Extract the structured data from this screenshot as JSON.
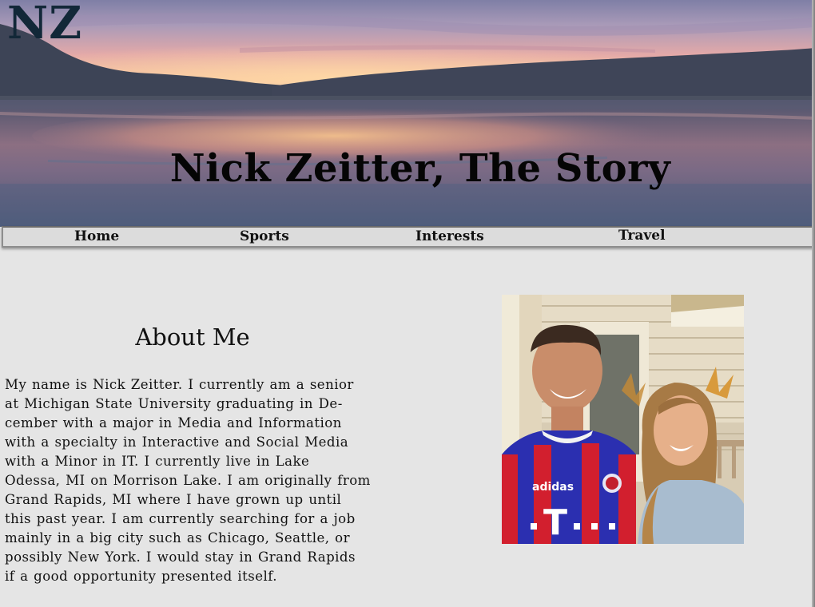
{
  "site": {
    "logo": "NZ",
    "title": "Nick Zeitter, The Story"
  },
  "nav": {
    "items": [
      {
        "label": "Home"
      },
      {
        "label": "Sports"
      },
      {
        "label": "Interests"
      },
      {
        "label": "Travel"
      }
    ]
  },
  "about": {
    "heading": "About Me",
    "body_lines": [
      "My name is Nick Zeitter. I currently am a senior",
      "at Michigan State University graduating in De-",
      "cember with a major in Media and Information",
      "with a specialty in Interactive and Social Media",
      "with a Minor in IT. I currently live in Lake",
      "Odessa, MI on Morrison Lake. I am originally from",
      "Grand Rapids, MI where I have grown up until",
      "this past year. I am currently searching for a job",
      "mainly in a big city such as Chicago, Seattle, or",
      "possibly New York. I would stay in Grand Rapids",
      "if a good opportunity presented itself."
    ]
  },
  "colors": {
    "page_background": "#e5e5e5",
    "logo_color": "#122838",
    "nav_background": "#dcdcdc",
    "text_color": "#111111"
  }
}
